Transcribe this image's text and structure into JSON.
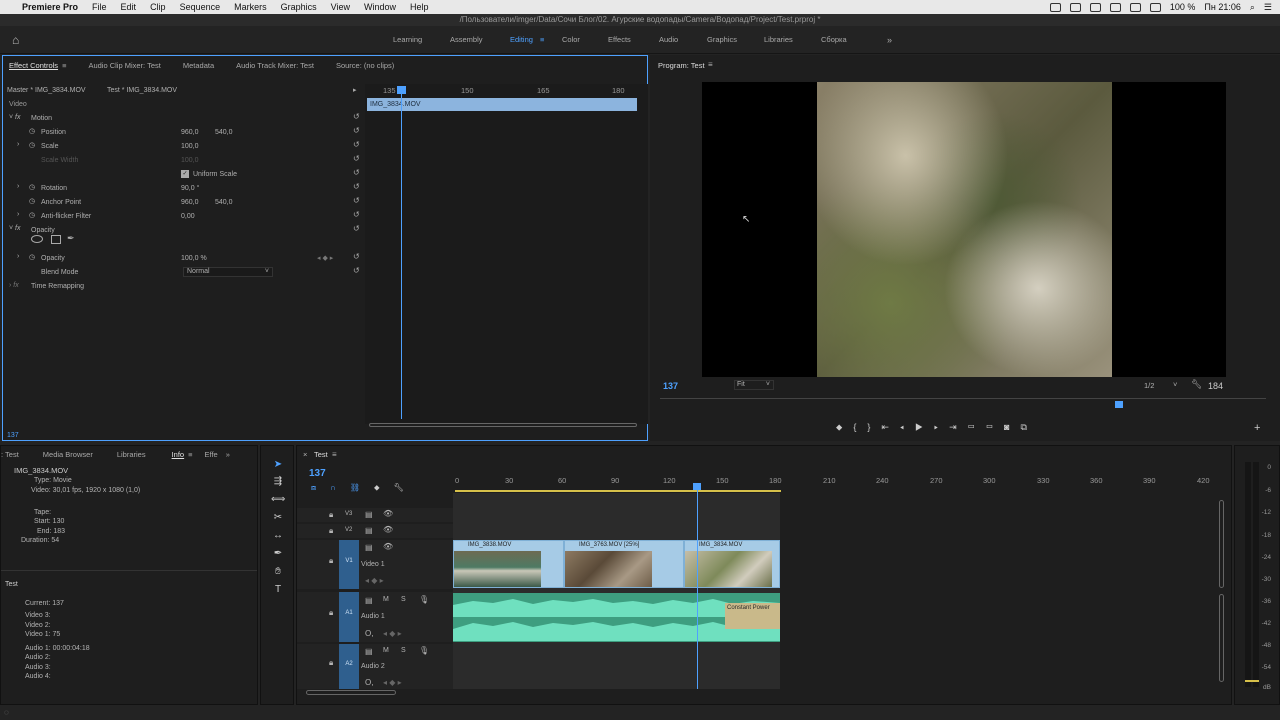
{
  "menubar": {
    "app_name": "Premiere Pro",
    "items": [
      "File",
      "Edit",
      "Clip",
      "Sequence",
      "Markers",
      "Graphics",
      "View",
      "Window",
      "Help"
    ],
    "battery": "100 %",
    "clock": "Пн 21:06"
  },
  "titlebar": {
    "path": "/Пользователи/imger/Data/Сочи Блог/02. Агурские водопады/Camera/Водопад/Project/Test.prproj *"
  },
  "workspaces": {
    "items": [
      "Learning",
      "Assembly",
      "Editing",
      "Color",
      "Effects",
      "Audio",
      "Graphics",
      "Libraries",
      "Сборка"
    ],
    "active": "Editing"
  },
  "effect_controls": {
    "tabs": [
      "Effect Controls",
      "Audio Clip Mixer: Test",
      "Metadata",
      "Audio Track Mixer: Test",
      "Source: (no clips)"
    ],
    "master": "Master * IMG_3834.MOV",
    "sequence_clip": "Test * IMG_3834.MOV",
    "section_video": "Video",
    "motion": "Motion",
    "position_label": "Position",
    "position_x": "960,0",
    "position_y": "540,0",
    "scale_label": "Scale",
    "scale_value": "100,0",
    "scale_width_label": "Scale Width",
    "scale_width_value": "100,0",
    "uniform_scale": "Uniform Scale",
    "rotation_label": "Rotation",
    "rotation_value": "90,0 °",
    "anchor_label": "Anchor Point",
    "anchor_x": "960,0",
    "anchor_y": "540,0",
    "antiflicker_label": "Anti-flicker Filter",
    "antiflicker_value": "0,00",
    "opacity_section": "Opacity",
    "opacity_label": "Opacity",
    "opacity_value": "100,0 %",
    "blend_label": "Blend Mode",
    "blend_value": "Normal",
    "time_remap": "Time Remapping",
    "mini_ruler": [
      "135",
      "150",
      "165",
      "180"
    ],
    "mini_clip": "IMG_3834.MOV",
    "timecode": "137"
  },
  "program": {
    "title": "Program: Test",
    "timecode_left": "137",
    "fit": "Fit",
    "resolution": "1/2",
    "timecode_right": "184"
  },
  "info_panel": {
    "tabs": [
      ": Test",
      "Media Browser",
      "Libraries",
      "Info",
      "Effe"
    ],
    "clip_name": "IMG_3834.MOV",
    "type": "Type: Movie",
    "video": "Video: 30,01 fps, 1920 x 1080 (1,0)",
    "tape": "Tape:",
    "start": "Start: 130",
    "end": "End: 183",
    "duration": "Duration: 54",
    "seq_name": "Test",
    "current": "Current: 137",
    "v3": "Video 3:",
    "v2": "Video 2:",
    "v1": "Video 1: 75",
    "a1": "Audio 1: 00:00:04:18",
    "a2": "Audio 2:",
    "a3": "Audio 3:",
    "a4": "Audio 4:"
  },
  "timeline": {
    "tab": "Test",
    "timecode": "137",
    "ruler": [
      "0",
      "30",
      "60",
      "90",
      "120",
      "150",
      "180",
      "210",
      "240",
      "270",
      "300",
      "330",
      "360",
      "390",
      "420"
    ],
    "tracks": {
      "v3": "V3",
      "v2": "V2",
      "v1": "V1",
      "video1": "Video 1",
      "a1": "A1",
      "audio1": "Audio 1",
      "a2": "A2",
      "audio2": "Audio 2"
    },
    "clips": [
      "IMG_3838.MOV",
      "IMG_3763.MOV [25%]",
      "IMG_3834.MOV"
    ],
    "transition": "Constant Power"
  },
  "meter": {
    "labels": [
      "0",
      "-6",
      "-12",
      "-18",
      "-24",
      "-30",
      "-36",
      "-42",
      "-48",
      "-54",
      "dB"
    ]
  },
  "colors": {
    "accent": "#4ea1ff",
    "clip_video": "#a6cbe6",
    "clip_audio": "#4fb99a"
  }
}
